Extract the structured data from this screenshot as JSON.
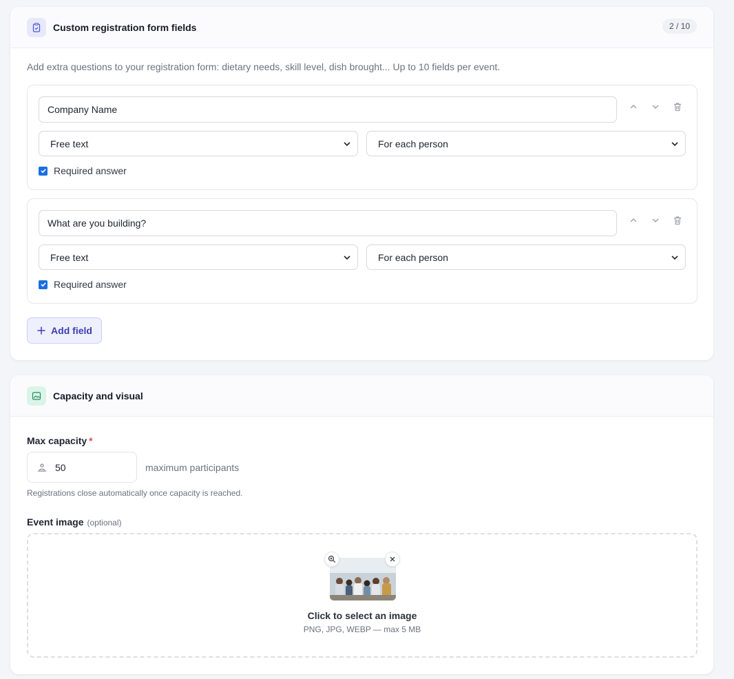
{
  "custom_fields": {
    "title": "Custom registration form fields",
    "count_badge": "2 / 10",
    "description": "Add extra questions to your registration form: dietary needs, skill level, dish brought... Up to 10 fields per event.",
    "fields": [
      {
        "question": "Company Name",
        "type": "Free text",
        "scope": "For each person",
        "required_label": "Required answer",
        "required": true
      },
      {
        "question": "What are you building?",
        "type": "Free text",
        "scope": "For each person",
        "required_label": "Required answer",
        "required": true
      }
    ],
    "add_button_label": "Add field"
  },
  "capacity": {
    "title": "Capacity and visual",
    "max_capacity_label": "Max capacity",
    "required_marker": "*",
    "max_capacity_value": "50",
    "capacity_suffix": "maximum participants",
    "capacity_hint": "Registrations close automatically once capacity is reached.",
    "event_image_label": "Event image",
    "event_image_optional": "(optional)",
    "dropzone_title": "Click to select an image",
    "dropzone_formats": "PNG, JPG, WEBP — max 5 MB"
  },
  "colors": {
    "accent": "#3b3fb0",
    "checkbox": "#1a6fe0",
    "required": "#e5484d"
  },
  "icons": {
    "custom_fields_header": "clipboard-icon",
    "capacity_header": "image-icon",
    "field_move_up": "chevron-up-icon",
    "field_move_down": "chevron-down-icon",
    "field_delete": "trash-icon",
    "add": "plus-icon",
    "capacity_input": "people-icon",
    "image_zoom": "zoom-icon",
    "image_remove": "close-icon"
  }
}
